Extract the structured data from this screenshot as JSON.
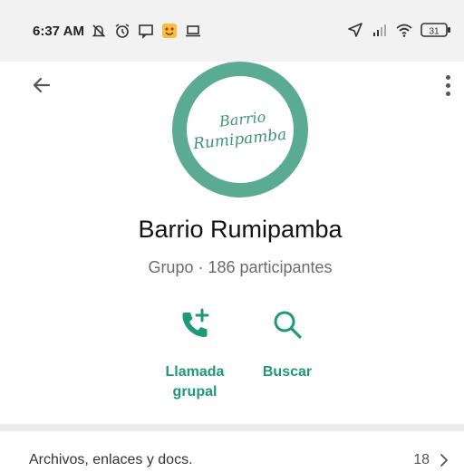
{
  "status_bar": {
    "time": "6:37 AM",
    "left_icons": [
      "muted-bell-icon",
      "alarm-clock-icon",
      "message-icon",
      "emoji-icon",
      "laptop-icon"
    ],
    "right_icons": [
      "location-arrow-icon",
      "signal-icon",
      "wifi-icon",
      "battery-icon"
    ],
    "battery_level": "31"
  },
  "header": {
    "back_icon": "arrow-left-icon",
    "menu_icon": "vertical-dots-icon"
  },
  "group": {
    "avatar_line1": "Barrio",
    "avatar_line2": "Rumipamba",
    "name": "Barrio Rumipamba",
    "subtitle": "Grupo · 186 participantes",
    "accent_color": "#1d9a78",
    "avatar_ring_color": "#5bab92"
  },
  "actions": [
    {
      "icon": "add-call-icon",
      "label_line1": "Llamada",
      "label_line2": "grupal"
    },
    {
      "icon": "search-icon",
      "label": "Buscar"
    }
  ],
  "media": {
    "label": "Archivos, enlaces y docs.",
    "count": "18"
  }
}
